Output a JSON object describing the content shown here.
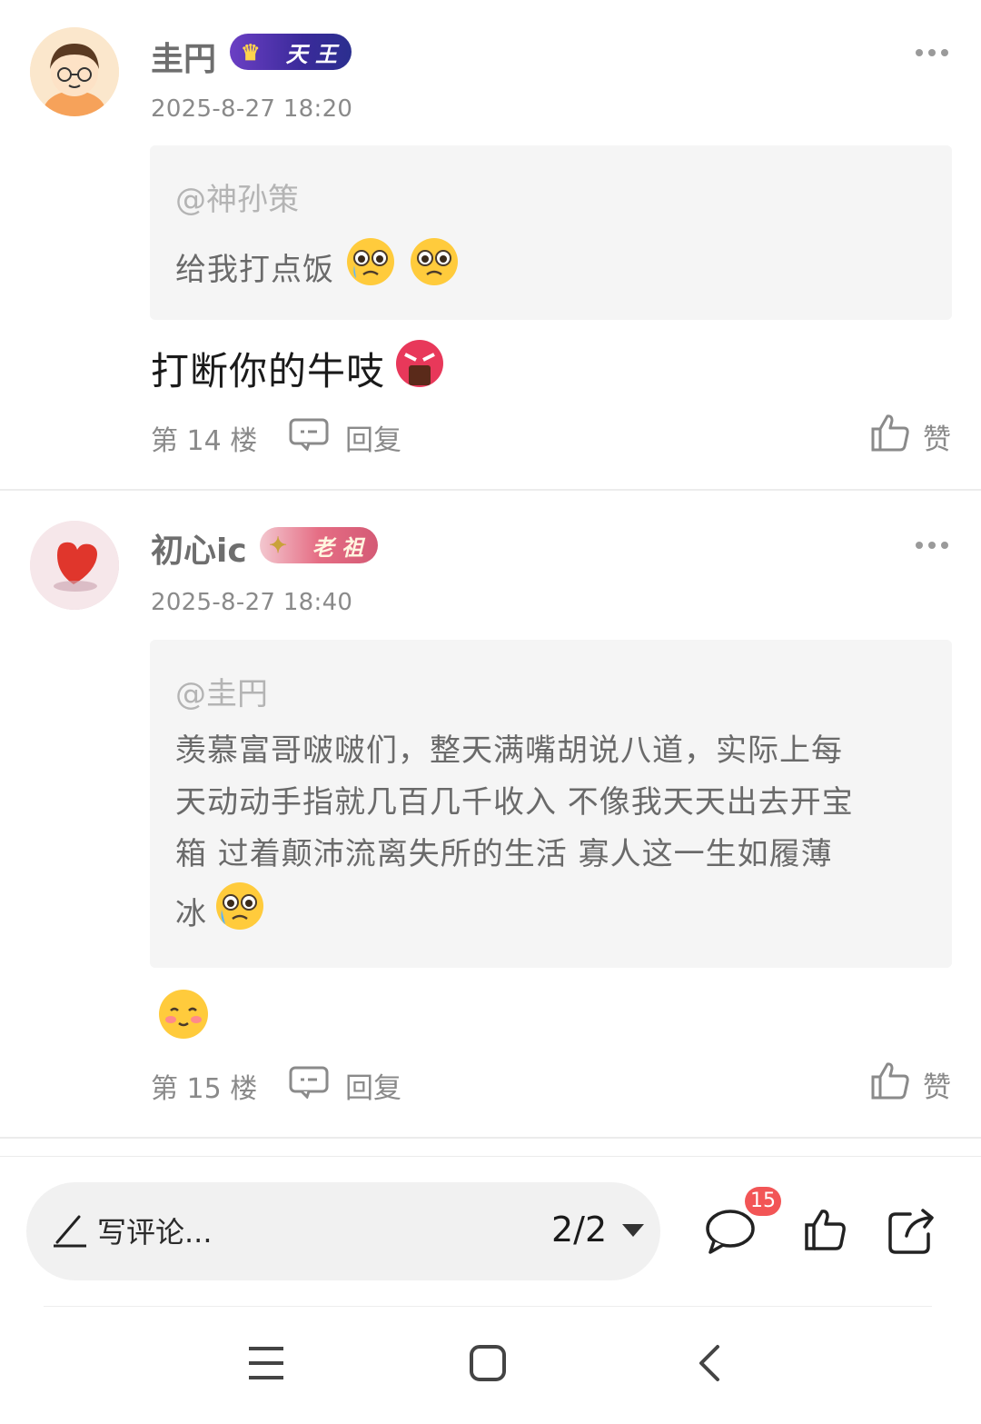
{
  "comments": [
    {
      "username": "圭円",
      "badge": "天 王",
      "badge_color": "#4a2fa8",
      "time": "2025-8-27 18:20",
      "quote_at": "@神孙策",
      "quote_text": "给我打点饭",
      "quote_emojis": [
        "crying-emoji",
        "crying-emoji"
      ],
      "text": "打断你的牛吱",
      "text_emojis": [
        "angry-emoji"
      ],
      "floor": "第 14 楼",
      "reply": "回复",
      "like": "赞"
    },
    {
      "username": "初心ic",
      "badge": "老 祖",
      "badge_color": "#c9587a",
      "time": "2025-8-27 18:40",
      "quote_at": "@圭円",
      "quote_lines": [
        "羡慕富哥啵啵们，整天满嘴胡说八道，实际上每",
        "天动动手指就几百几千收入 不像我天天出去开宝",
        "箱 过着颠沛流离失所的生活 寡人这一生如履薄",
        "冰"
      ],
      "quote_emojis": [
        "crying-emoji"
      ],
      "text_emojis": [
        "blush-emoji"
      ],
      "floor": "第 15 楼",
      "reply": "回复",
      "like": "赞"
    }
  ],
  "bottom_bar": {
    "placeholder": "写评论...",
    "pager": "2/2",
    "comment_count": "15"
  },
  "colors": {
    "accent_badge": "#f25556",
    "quote_bg": "#f5f5f5"
  }
}
